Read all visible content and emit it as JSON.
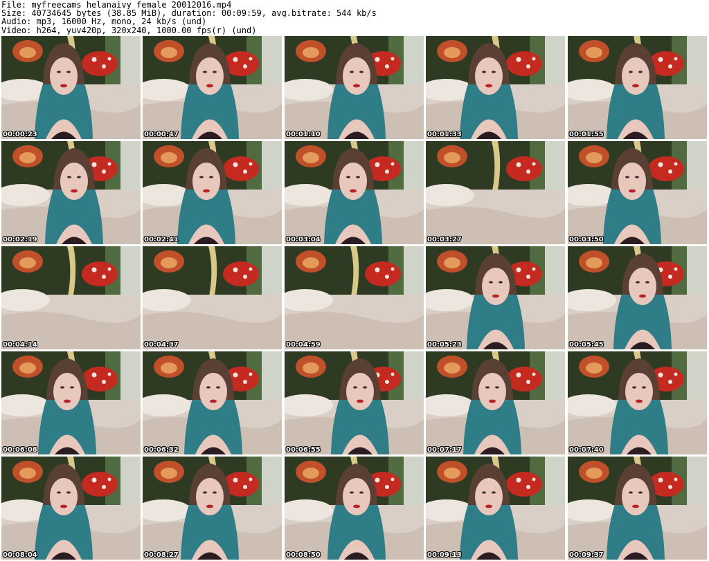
{
  "header": {
    "file_line": "File: myfreecams_helanaivy_female_20012016.mp4",
    "size_line": "Size: 40734645 bytes (38.85 MiB), duration: 00:09:59, avg.bitrate: 544 kb/s",
    "audio_line": "Audio: mp3, 16000 Hz, mono, 24 kb/s (und)",
    "video_line": "Video: h264, yuv420p, 320x240, 1000.00 fps(r) (und)"
  },
  "colors": {
    "wall": "#2e3b22",
    "bed": "#d9cfc6",
    "hair": "#2f7d86",
    "hair_top": "#5a3f35",
    "skin": "#e8c8bc",
    "mushroom_red": "#c42a1f"
  },
  "frames": [
    {
      "timestamp": "00:00:23",
      "person": true
    },
    {
      "timestamp": "00:00:47",
      "person": true
    },
    {
      "timestamp": "00:01:10",
      "person": true
    },
    {
      "timestamp": "00:01:33",
      "person": true
    },
    {
      "timestamp": "00:01:55",
      "person": true
    },
    {
      "timestamp": "00:02:19",
      "person": true
    },
    {
      "timestamp": "00:02:41",
      "person": true
    },
    {
      "timestamp": "00:03:04",
      "person": true
    },
    {
      "timestamp": "00:03:27",
      "person": false
    },
    {
      "timestamp": "00:03:50",
      "person": true
    },
    {
      "timestamp": "00:04:14",
      "person": false
    },
    {
      "timestamp": "00:04:37",
      "person": false
    },
    {
      "timestamp": "00:04:59",
      "person": false
    },
    {
      "timestamp": "00:05:23",
      "person": true
    },
    {
      "timestamp": "00:05:45",
      "person": true
    },
    {
      "timestamp": "00:06:08",
      "person": true
    },
    {
      "timestamp": "00:06:32",
      "person": true
    },
    {
      "timestamp": "00:06:55",
      "person": true
    },
    {
      "timestamp": "00:07:17",
      "person": true
    },
    {
      "timestamp": "00:07:40",
      "person": true
    },
    {
      "timestamp": "00:08:04",
      "person": true
    },
    {
      "timestamp": "00:08:27",
      "person": true
    },
    {
      "timestamp": "00:08:50",
      "person": true
    },
    {
      "timestamp": "00:09:13",
      "person": true
    },
    {
      "timestamp": "00:09:37",
      "person": true
    }
  ]
}
